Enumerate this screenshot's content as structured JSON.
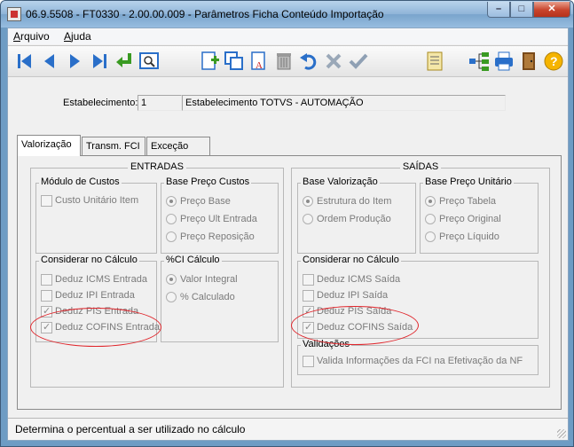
{
  "window": {
    "title": "06.9.5508 - FT0330 - 2.00.00.009 - Parâmetros Ficha Conteúdo Importação",
    "min": "–",
    "max": "□",
    "close": "✕"
  },
  "menu": [
    {
      "label": "Arquivo",
      "hotkey": "A",
      "rest": "rquivo"
    },
    {
      "label": "Ajuda",
      "hotkey": "A",
      "rest": "juda"
    }
  ],
  "toolbar": {
    "buttons": [
      {
        "name": "first-record",
        "icon": "first-icon"
      },
      {
        "name": "previous-record",
        "icon": "prev-icon"
      },
      {
        "name": "next-record",
        "icon": "next-icon"
      },
      {
        "name": "last-record",
        "icon": "last-icon"
      },
      {
        "name": "goto-record",
        "icon": "goto-icon"
      },
      {
        "name": "search",
        "icon": "search-icon"
      },
      {
        "name": "add",
        "icon": "add-icon"
      },
      {
        "name": "copy",
        "icon": "copy-icon"
      },
      {
        "name": "edit",
        "icon": "edit-icon"
      },
      {
        "name": "delete",
        "icon": "trash-icon"
      },
      {
        "name": "undo",
        "icon": "undo-icon"
      },
      {
        "name": "cancel",
        "icon": "cancel-icon"
      },
      {
        "name": "save",
        "icon": "check-icon"
      },
      {
        "name": "report",
        "icon": "report-icon"
      },
      {
        "name": "hierarchy",
        "icon": "tree-icon"
      },
      {
        "name": "print",
        "icon": "print-icon"
      },
      {
        "name": "exit",
        "icon": "exit-door-icon"
      },
      {
        "name": "help",
        "icon": "help-icon"
      }
    ]
  },
  "estabelecimento": {
    "label": "Estabelecimento:",
    "code": "1",
    "description": "Estabelecimento TOTVS - AUTOMAÇÃO"
  },
  "tabs": [
    {
      "label": "Valorização",
      "active": true
    },
    {
      "label": "Transm. FCI",
      "active": false
    },
    {
      "label": "Exceção",
      "active": false
    }
  ],
  "entradas": {
    "title": "ENTRADAS",
    "modulo_custos": {
      "title": "Módulo de Custos",
      "custo_unitario": {
        "label": "Custo Unitário Item",
        "checked": false
      }
    },
    "base_preco_custos": {
      "title": "Base Preço Custos",
      "options": [
        {
          "label": "Preço Base",
          "selected": true
        },
        {
          "label": "Preço Ult Entrada",
          "selected": false
        },
        {
          "label": "Preço Reposição",
          "selected": false
        }
      ]
    },
    "considerar": {
      "title": "Considerar no Cálculo",
      "items": [
        {
          "label": "Deduz ICMS Entrada",
          "checked": false
        },
        {
          "label": "Deduz IPI Entrada",
          "checked": false
        },
        {
          "label": "Deduz PIS Entrada",
          "checked": true
        },
        {
          "label": "Deduz COFINS Entrada",
          "checked": true
        }
      ]
    },
    "ci_calculo": {
      "title": "%CI Cálculo",
      "options": [
        {
          "label": "Valor Integral",
          "selected": true
        },
        {
          "label": "% Calculado",
          "selected": false
        }
      ]
    }
  },
  "saidas": {
    "title": "SAÍDAS",
    "base_valorizacao": {
      "title": "Base Valorização",
      "options": [
        {
          "label": "Estrutura do Item",
          "selected": true
        },
        {
          "label": "Ordem Produção",
          "selected": false
        }
      ]
    },
    "base_preco_unitario": {
      "title": "Base Preço Unitário",
      "options": [
        {
          "label": "Preço Tabela",
          "selected": true
        },
        {
          "label": "Preço Original",
          "selected": false
        },
        {
          "label": "Preço Líquido",
          "selected": false
        }
      ]
    },
    "considerar": {
      "title": "Considerar no Cálculo",
      "items": [
        {
          "label": "Deduz ICMS Saída",
          "checked": false
        },
        {
          "label": "Deduz IPI Saída",
          "checked": false
        },
        {
          "label": "Deduz PIS Saída",
          "checked": true
        },
        {
          "label": "Deduz COFINS Saída",
          "checked": true
        }
      ]
    },
    "validacoes": {
      "title": "Validações",
      "item": {
        "label": "Valida Informações da FCI na Efetivação da NF",
        "checked": false
      }
    }
  },
  "status": {
    "text": "Determina o percentual a ser utilizado no cálculo"
  },
  "colors": {
    "highlight": "#e0242a",
    "toolbar_blue": "#2a6fc9"
  }
}
